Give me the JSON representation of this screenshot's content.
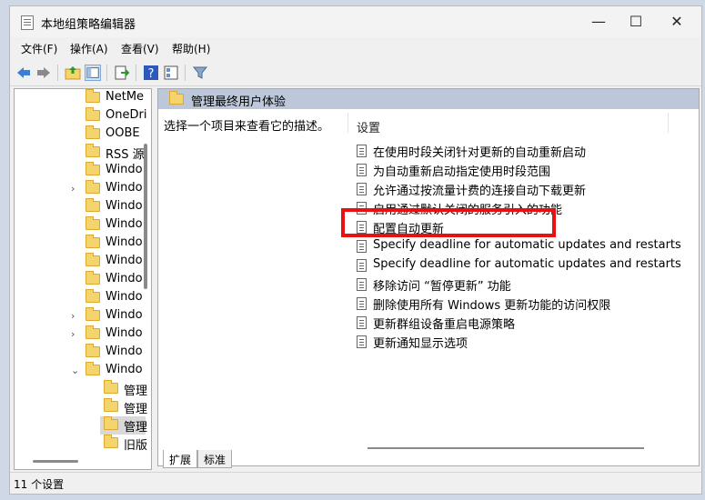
{
  "window": {
    "title": "本地组策略编辑器",
    "minimize": "—",
    "maximize": "☐",
    "close": "✕"
  },
  "menu": [
    "文件(F)",
    "操作(A)",
    "查看(V)",
    "帮助(H)"
  ],
  "toolbar": {
    "icons": [
      "back-arrow-icon",
      "forward-arrow-icon",
      "up-folder-icon",
      "show-hide-tree-icon",
      "export-list-icon",
      "help-icon",
      "properties-icon",
      "filter-icon"
    ]
  },
  "tree": {
    "items": [
      {
        "label": "NetMe",
        "expander": ""
      },
      {
        "label": "OneDri",
        "expander": ""
      },
      {
        "label": "OOBE",
        "expander": ""
      },
      {
        "label": "RSS 源",
        "expander": ""
      },
      {
        "label": "Windo",
        "expander": ""
      },
      {
        "label": "Windo",
        "expander": "›"
      },
      {
        "label": "Windo",
        "expander": ""
      },
      {
        "label": "Windo",
        "expander": ""
      },
      {
        "label": "Windo",
        "expander": ""
      },
      {
        "label": "Windo",
        "expander": ""
      },
      {
        "label": "Windo",
        "expander": ""
      },
      {
        "label": "Windo",
        "expander": ""
      },
      {
        "label": "Windo",
        "expander": "›"
      },
      {
        "label": "Windo",
        "expander": "›"
      },
      {
        "label": "Windo",
        "expander": ""
      },
      {
        "label": "Windo",
        "expander": "⌄"
      }
    ],
    "subitems": [
      {
        "label": "管理"
      },
      {
        "label": "管理"
      },
      {
        "label": "管理"
      },
      {
        "label": "旧版"
      }
    ]
  },
  "pane": {
    "title": "管理最终用户体验",
    "description": "选择一个项目来查看它的描述。",
    "column_header": "设置",
    "settings": [
      "在使用时段关闭针对更新的自动重新启动",
      "为自动重新启动指定使用时段范围",
      "允许通过按流量计费的连接自动下载更新",
      "启用通过默认关闭的服务引入的功能",
      "配置自动更新",
      "Specify deadline for automatic updates and restarts f...",
      "Specify deadline for automatic updates and restarts f...",
      "移除访问 “暂停更新” 功能",
      "删除使用所有 Windows 更新功能的访问权限",
      "更新群组设备重启电源策略",
      "更新通知显示选项"
    ]
  },
  "tabs": [
    "扩展",
    "标准"
  ],
  "status": "11 个设置",
  "colors": {
    "highlight": "#e81010",
    "pane_header": "#bcc8d9",
    "folder": "#f5d46b"
  }
}
